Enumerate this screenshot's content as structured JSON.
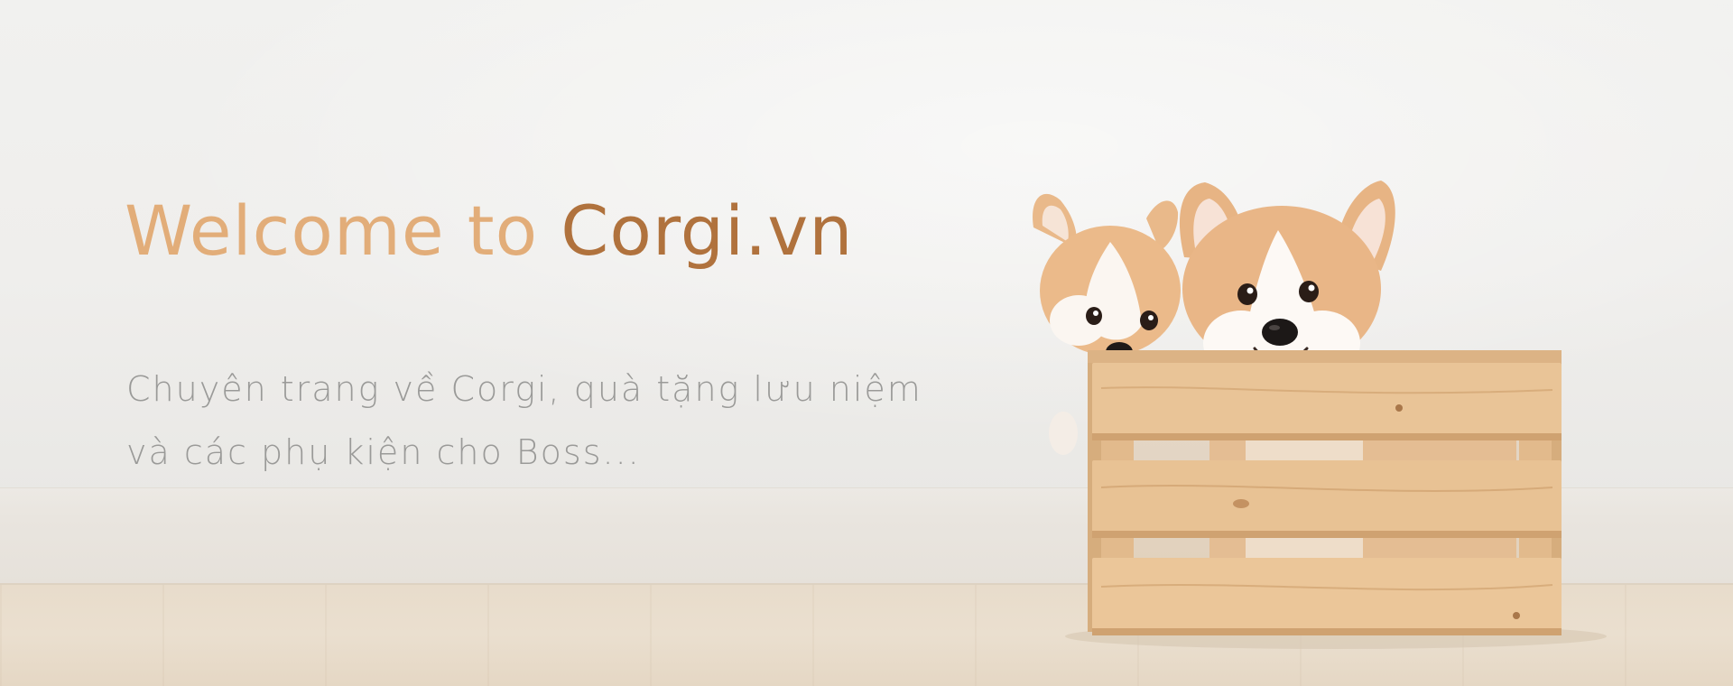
{
  "hero": {
    "headline_prefix": "Welcome to ",
    "headline_brand": "Corgi.vn",
    "subtitle_line1": "Chuyên trang về Corgi, quà tặng lưu niệm",
    "subtitle_line2": "và các phụ kiện cho Boss..."
  },
  "colors": {
    "headline_light": "#e2ad79",
    "headline_brand": "#b0723d",
    "subtitle": "#9a9a98",
    "wall": "#efeeec",
    "floor": "#e8dccb",
    "crate_wood": "#e7c196"
  },
  "image": {
    "subject": "corgi-puppies-in-wooden-crate"
  }
}
